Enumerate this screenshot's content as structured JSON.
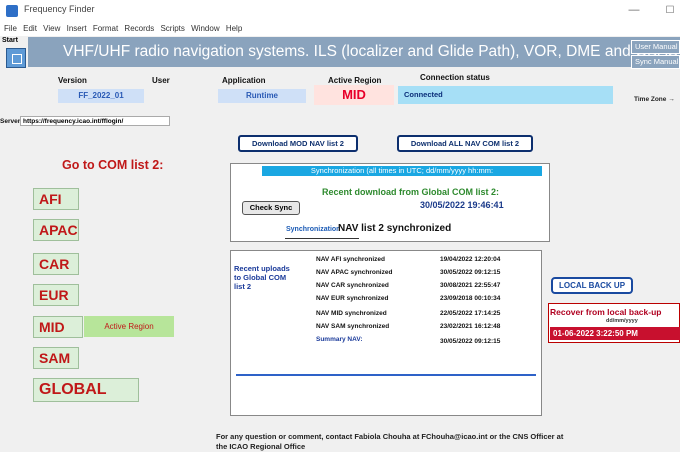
{
  "window": {
    "title": "Frequency Finder",
    "minimize_glyph": "—",
    "maximize_glyph": "☐"
  },
  "menu": [
    "File",
    "Edit",
    "View",
    "Insert",
    "Format",
    "Records",
    "Scripts",
    "Window",
    "Help"
  ],
  "start_label": "Start",
  "header": {
    "title": "VHF/UHF radio navigation systems. ILS (localizer and Glide Path), VOR, DME and GBAS",
    "user_manual": "User Manual",
    "sync_manual": "Sync Manual"
  },
  "info": {
    "version_label": "Version",
    "version_value": "FF_2022_01",
    "user_label": "User",
    "application_label": "Application",
    "application_value": "Runtime",
    "active_region_label": "Active Region",
    "active_region_value": "MID",
    "connection_label": "Connection status",
    "connection_value": "Connected",
    "time_zone_label": "Time Zone  →"
  },
  "server": {
    "label": "Server",
    "value": "https://frequency.icao.int/fflogin/"
  },
  "left": {
    "go_com": "Go to COM list 2:",
    "regions": [
      "AFI",
      "APAC",
      "CAR",
      "EUR",
      "MID",
      "SAM",
      "GLOBAL"
    ],
    "active_region_tag": "Active Region"
  },
  "center": {
    "download_mod": "Download MOD NAV list 2",
    "download_all": "Download ALL NAV COM list 2",
    "sync_bar": "Synchronization (all times in UTC; dd/mm/yyyy hh:mm:",
    "recent_download": "Recent download from Global COM list 2:",
    "recent_date": "30/05/2022 19:46:41",
    "check_sync": "Check Sync",
    "sync_label": "Synchronization",
    "sync_status": "NAV list 2 synchronized",
    "uploads_label": "Recent uploads to Global COM list 2",
    "nav_rows": [
      {
        "name": "NAV AFI synchronized",
        "date": "19/04/2022 12:20:04"
      },
      {
        "name": "NAV APAC synchronized",
        "date": "30/05/2022 09:12:15"
      },
      {
        "name": "NAV CAR synchronized",
        "date": "30/08/2021 22:55:47"
      },
      {
        "name": "NAV EUR synchronized",
        "date": "23/09/2018 00:10:34"
      },
      {
        "name": "NAV MID synchronized",
        "date": "22/05/2022 17:14:25"
      },
      {
        "name": "NAV SAM synchronized",
        "date": "23/02/2021 16:12:48"
      },
      {
        "name": "Summary NAV:",
        "date": "30/05/2022 09:12:15"
      }
    ]
  },
  "right": {
    "local_backup": "LOCAL BACK UP",
    "recover_title": "Recover from local back-up",
    "recover_format": "dd/mm/yyyy",
    "recover_value": "01-06-2022 3:22:50 PM"
  },
  "footer": "For any question or comment, contact Fabiola Chouha at FChouha@icao.int or the CNS Officer at the ICAO Regional Office"
}
